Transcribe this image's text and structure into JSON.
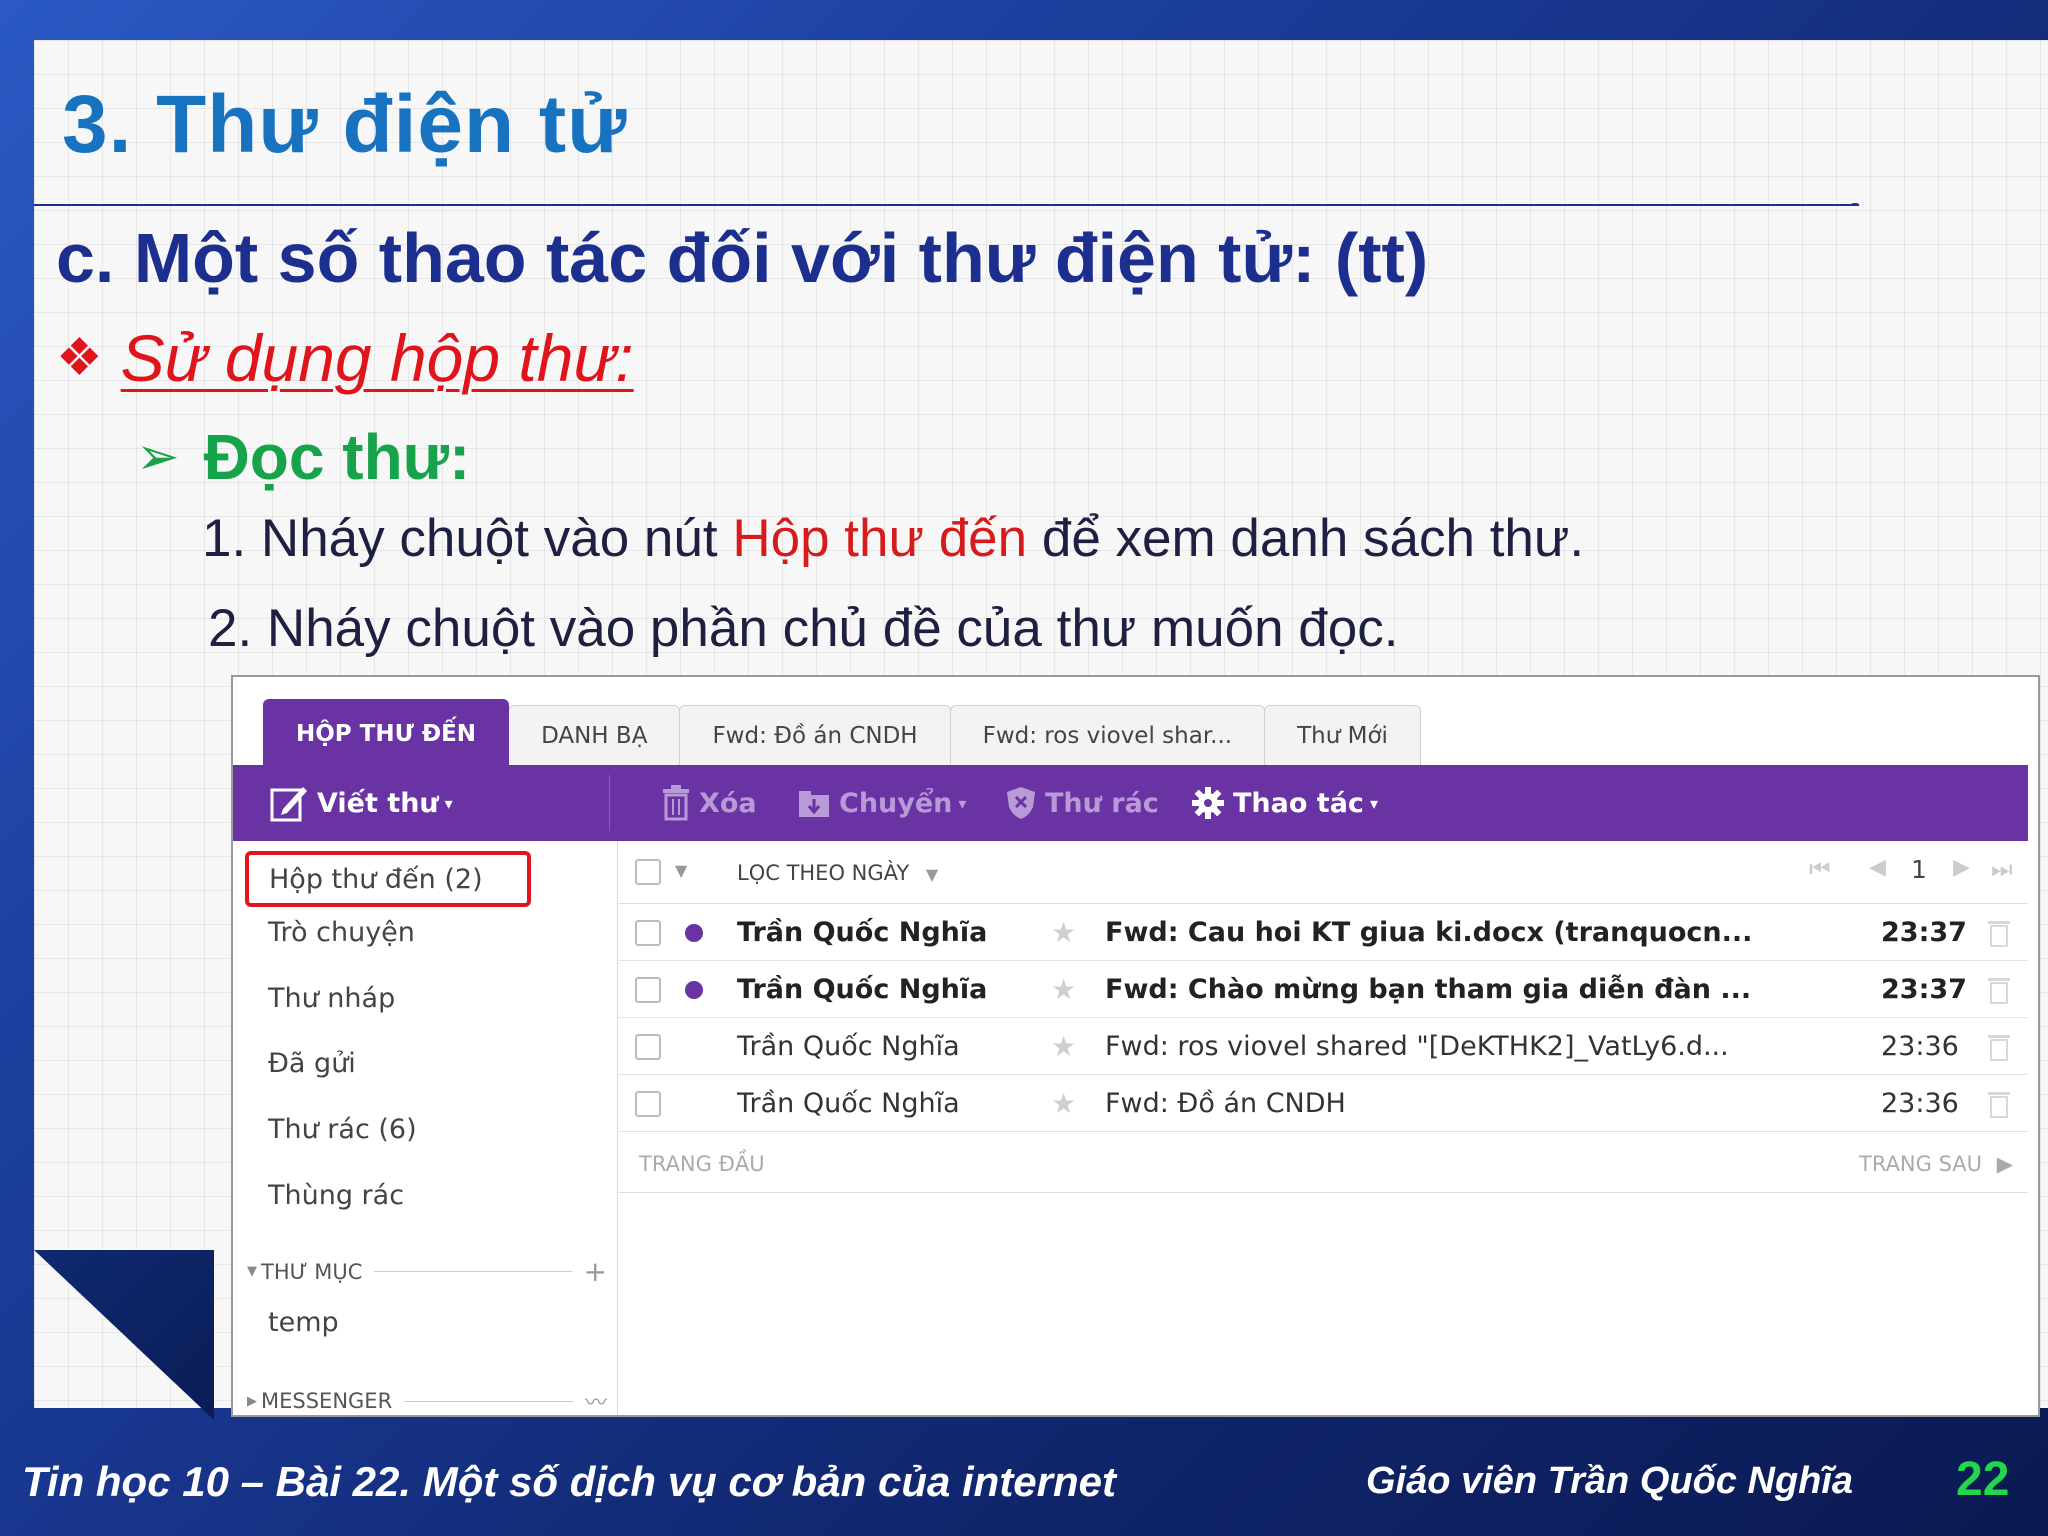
{
  "slide": {
    "title": "3. Thư điện tử",
    "subtitle": "c. Một số thao tác đối với thư điện tử: (tt)",
    "bullet_level1": "Sử dụng hộp thư:",
    "bullet_level2": "Đọc thư:",
    "step1": {
      "prefix": "1.  Nháy chuột vào nút ",
      "highlight": "Hộp thư đến",
      "suffix": " để xem danh sách thư."
    },
    "step2": "2. Nháy chuột vào phần chủ đề của thư muốn đọc.",
    "footer_left": "Tin học 10 – Bài 22. Một số dịch vụ cơ bản của internet",
    "footer_right": "Giáo viên Trần Quốc Nghĩa",
    "page_number": "22",
    "colors": {
      "title": "#1772c0",
      "subtitle": "#1c2e8e",
      "bullet1": "#e0141b",
      "bullet2": "#16a34a",
      "highlight": "#d51b1b",
      "page_number": "#22d84a"
    }
  },
  "mail": {
    "tabs": [
      "HỘP THƯ ĐẾN",
      "DANH BẠ",
      "Fwd: Đồ án CNDH",
      "Fwd: ros viovel shar...",
      "Thư Mới"
    ],
    "toolbar": {
      "compose": "Viết thư",
      "delete": "Xóa",
      "move": "Chuyển",
      "spam": "Thư rác",
      "actions": "Thao tác"
    },
    "folders": [
      "Hộp thư đến (2)",
      "Trò chuyện",
      "Thư nháp",
      "Đã gửi",
      "Thư rác (6)",
      "Thùng rác"
    ],
    "folders_section": "THƯ MỤC",
    "custom_folders": [
      "temp"
    ],
    "messenger_section": "MESSENGER",
    "list_header": {
      "sort_label": "LỌC THEO NGÀY",
      "page": "1"
    },
    "messages": [
      {
        "sender": "Trần Quốc Nghĩa",
        "subject": "Fwd: Cau hoi KT giua ki.docx (tranquocn...",
        "time": "23:37",
        "unread": true
      },
      {
        "sender": "Trần Quốc Nghĩa",
        "subject": "Fwd: Chào mừng bạn tham gia diễn đàn ...",
        "time": "23:37",
        "unread": true
      },
      {
        "sender": "Trần Quốc Nghĩa",
        "subject": "Fwd: ros viovel shared \"[DeKTHK2]_VatLy6.d...",
        "time": "23:36",
        "unread": false
      },
      {
        "sender": "Trần Quốc Nghĩa",
        "subject": "Fwd: Đồ án CNDH",
        "time": "23:36",
        "unread": false
      }
    ],
    "pager": {
      "first": "TRANG ĐẦU",
      "next": "TRANG SAU"
    },
    "colors": {
      "accent": "#6a33a4",
      "selection_outline": "#e0141b"
    }
  }
}
